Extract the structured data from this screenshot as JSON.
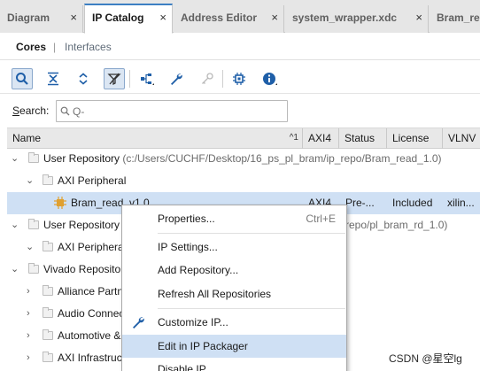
{
  "tabs": [
    {
      "label": "Diagram",
      "active": false
    },
    {
      "label": "IP Catalog",
      "active": true
    },
    {
      "label": "Address Editor",
      "active": false
    },
    {
      "label": "system_wrapper.xdc",
      "active": false
    },
    {
      "label": "Bram_re",
      "active": false
    }
  ],
  "subtabs": {
    "cores": "Cores",
    "separator": "|",
    "interfaces": "Interfaces"
  },
  "toolbar": {
    "icons": [
      "search-icon",
      "collapse-all-icon",
      "expand-all-icon",
      "filter-icon",
      "hierarchy-icon",
      "wrench-icon",
      "key-icon",
      "chip-icon",
      "info-icon"
    ]
  },
  "search": {
    "label": "Search:",
    "placeholder": "Q-",
    "value": ""
  },
  "table": {
    "columns": {
      "name": "Name",
      "sort_indicator": "^1",
      "axi4": "AXI4",
      "status": "Status",
      "license": "License",
      "vlnv": "VLNV"
    },
    "rows": [
      {
        "label": "User Repository",
        "detail": " (c:/Users/CUCHF/Desktop/16_ps_pl_bram/ip_repo/Bram_read_1.0)"
      },
      {
        "label": "AXI Peripheral"
      },
      {
        "label": "Bram_read_v1.0",
        "axi4": "AXI4",
        "status": "Pre-...",
        "license": "Included",
        "vlnv": "xilin..."
      },
      {
        "label": "User Repository",
        "detail_tail": "repo/pl_bram_rd_1.0)"
      },
      {
        "label": "AXI Peripheral"
      },
      {
        "label": "Vivado Repository"
      },
      {
        "label": "Alliance Partner"
      },
      {
        "label": "Audio Connectivity"
      },
      {
        "label": "Automotive &"
      },
      {
        "label": "AXI Infrastructure"
      }
    ]
  },
  "context_menu": {
    "items": [
      {
        "label": "Properties...",
        "accelerator": "Ctrl+E"
      },
      {
        "label": "IP Settings..."
      },
      {
        "label": "Add Repository..."
      },
      {
        "label": "Refresh All Repositories"
      },
      {
        "label": "Customize IP..."
      },
      {
        "label": "Edit in IP Packager"
      },
      {
        "label": "Disable IP"
      }
    ]
  },
  "colors": {
    "selection": "#cfe0f4",
    "accent": "#3c7fc3",
    "info": "#1f5fa8"
  },
  "watermark": "CSDN @星空lg"
}
